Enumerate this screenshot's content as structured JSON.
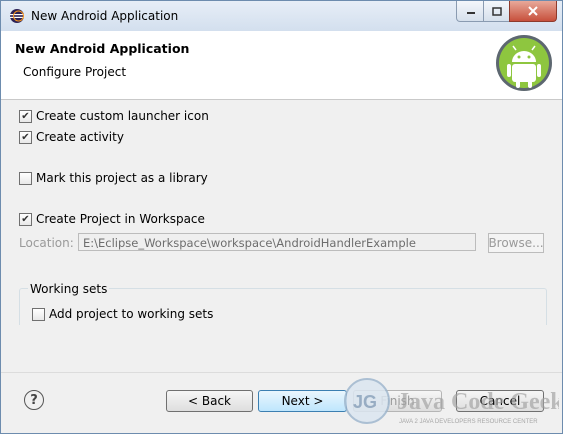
{
  "window": {
    "title": "New Android Application"
  },
  "header": {
    "title": "New Android Application",
    "subtitle": "Configure Project"
  },
  "options": {
    "launcher_icon": {
      "label": "Create custom launcher icon",
      "checked": true
    },
    "activity": {
      "label": "Create activity",
      "checked": true
    },
    "library": {
      "label": "Mark this project as a library",
      "checked": false
    },
    "workspace": {
      "label": "Create Project in Workspace",
      "checked": true
    }
  },
  "location": {
    "label": "Location:",
    "value": "E:\\Eclipse_Workspace\\workspace\\AndroidHandlerExample",
    "browse_label": "Browse..."
  },
  "working_sets": {
    "group_label": "Working sets",
    "add_label": "Add project to working sets",
    "checked": false
  },
  "buttons": {
    "back": "< Back",
    "next": "Next >",
    "finish": "Finish",
    "cancel": "Cancel"
  },
  "watermark": {
    "brand": "Java Code Geeks",
    "tagline": "JAVA 2 JAVA DEVELOPERS RESOURCE CENTER"
  }
}
